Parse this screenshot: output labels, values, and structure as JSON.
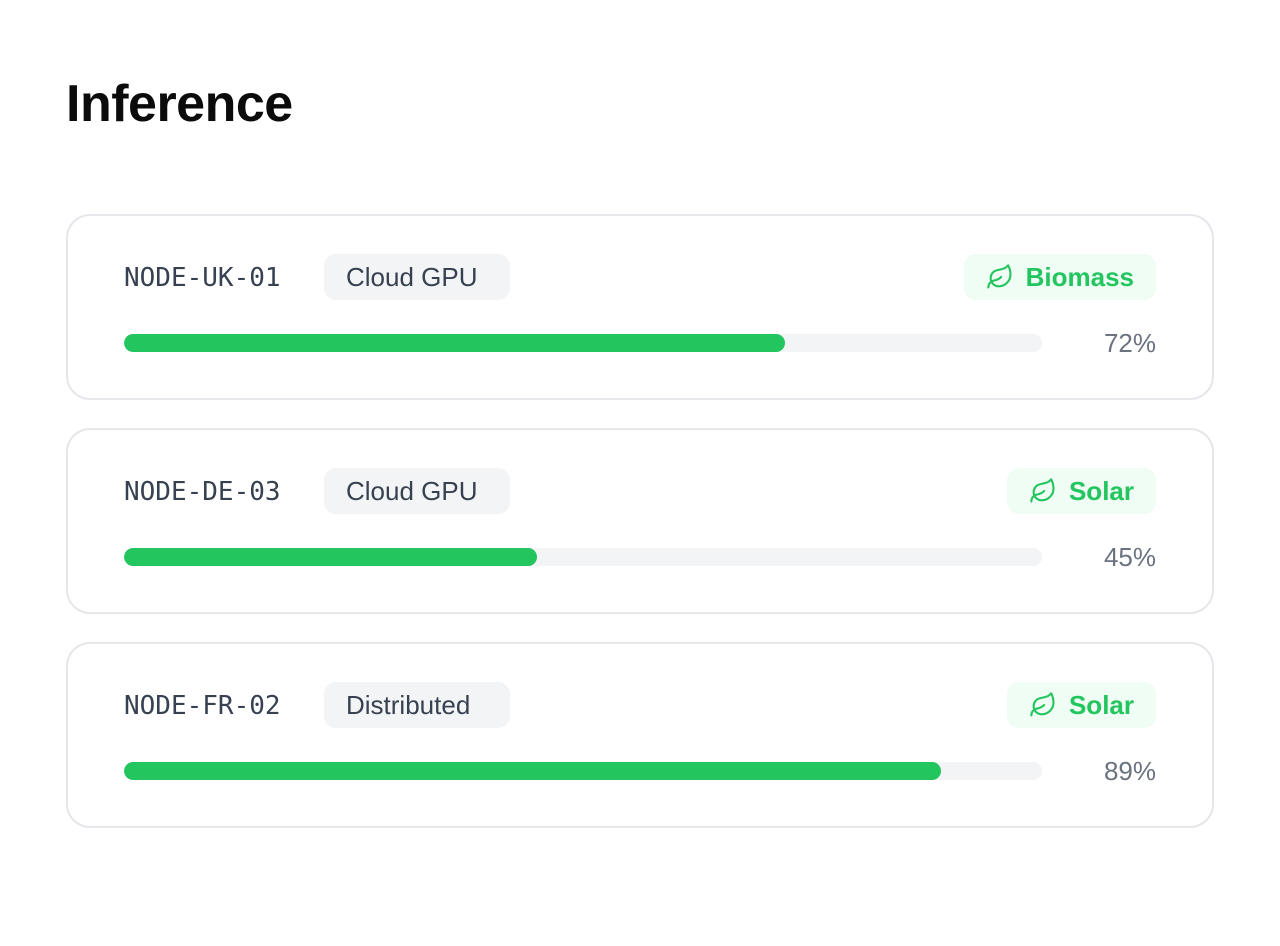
{
  "page": {
    "title": "Inference"
  },
  "colors": {
    "accent": "#22c55e",
    "badge_bg": "#f0fdf4",
    "chip_bg": "#f3f4f6",
    "track_bg": "#f3f4f6",
    "border": "#e5e7eb"
  },
  "nodes": [
    {
      "id": "NODE-UK-01",
      "type": "Cloud GPU",
      "source": "Biomass",
      "source_icon": "leaf-icon",
      "utilization": 72,
      "utilization_label": "72%"
    },
    {
      "id": "NODE-DE-03",
      "type": "Cloud GPU",
      "source": "Solar",
      "source_icon": "leaf-icon",
      "utilization": 45,
      "utilization_label": "45%"
    },
    {
      "id": "NODE-FR-02",
      "type": "Distributed",
      "source": "Solar",
      "source_icon": "leaf-icon",
      "utilization": 89,
      "utilization_label": "89%"
    }
  ]
}
